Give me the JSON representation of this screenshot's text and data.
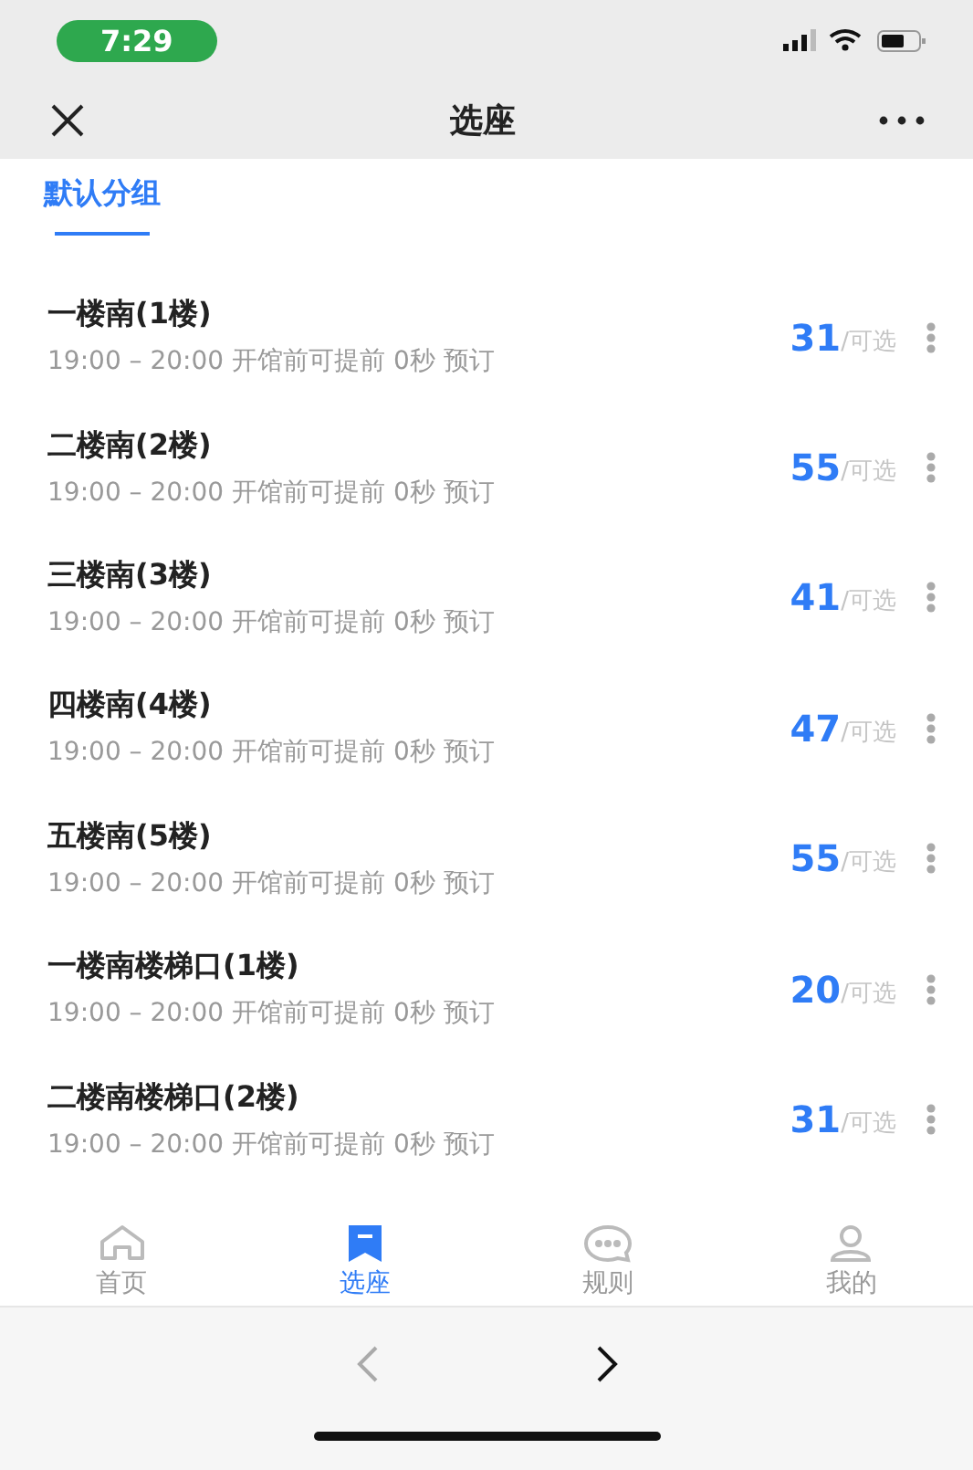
{
  "status_bar": {
    "time": "7:29"
  },
  "nav_bar": {
    "title": "选座"
  },
  "group_tabs": [
    {
      "label": "默认分组",
      "selected": true
    }
  ],
  "rooms": [
    {
      "name": "一楼南(1楼)",
      "info": "19:00 – 20:00 开馆前可提前 0秒 预订",
      "count": "31",
      "unit": "/可选"
    },
    {
      "name": "二楼南(2楼)",
      "info": "19:00 – 20:00 开馆前可提前 0秒 预订",
      "count": "55",
      "unit": "/可选"
    },
    {
      "name": "三楼南(3楼)",
      "info": "19:00 – 20:00 开馆前可提前 0秒 预订",
      "count": "41",
      "unit": "/可选"
    },
    {
      "name": "四楼南(4楼)",
      "info": "19:00 – 20:00 开馆前可提前 0秒 预订",
      "count": "47",
      "unit": "/可选"
    },
    {
      "name": "五楼南(5楼)",
      "info": "19:00 – 20:00 开馆前可提前 0秒 预订",
      "count": "55",
      "unit": "/可选"
    },
    {
      "name": "一楼南楼梯口(1楼)",
      "info": "19:00 – 20:00 开馆前可提前 0秒 预订",
      "count": "20",
      "unit": "/可选"
    },
    {
      "name": "二楼南楼梯口(2楼)",
      "info": "19:00 – 20:00 开馆前可提前 0秒 预订",
      "count": "31",
      "unit": "/可选"
    }
  ],
  "tab_bar": [
    {
      "kind": "home",
      "label": "首页",
      "selected": false
    },
    {
      "kind": "seat",
      "label": "选座",
      "selected": true
    },
    {
      "kind": "rules",
      "label": "规则",
      "selected": false
    },
    {
      "kind": "me",
      "label": "我的",
      "selected": false
    }
  ],
  "browser_bar": {
    "back": {
      "disabled": true
    },
    "forward": {
      "disabled": false
    }
  }
}
